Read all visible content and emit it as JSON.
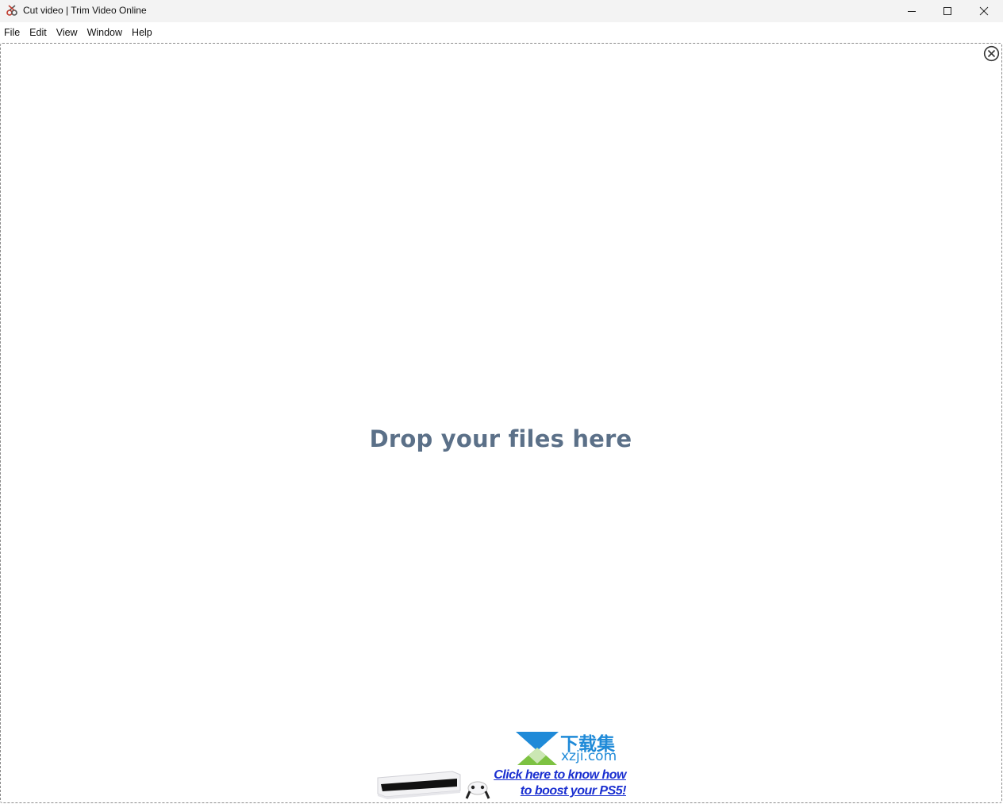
{
  "window": {
    "title": "Cut video | Trim Video Online",
    "controls": {
      "minimize": "minimize-icon",
      "maximize": "maximize-icon",
      "close": "close-icon"
    }
  },
  "menu": {
    "items": [
      {
        "label": "File"
      },
      {
        "label": "Edit"
      },
      {
        "label": "View"
      },
      {
        "label": "Window"
      },
      {
        "label": "Help"
      }
    ]
  },
  "dropzone": {
    "text": "Drop your files here",
    "close_icon": "circle-x-icon",
    "text_color": "#5b7088"
  },
  "ad": {
    "line1": "Click here to know how",
    "line2": "to boost your PS5!",
    "link_color": "#1a2fd0"
  },
  "watermark": {
    "cn": "下载集",
    "en": "xzji.com",
    "color": "#1f8ad8"
  }
}
